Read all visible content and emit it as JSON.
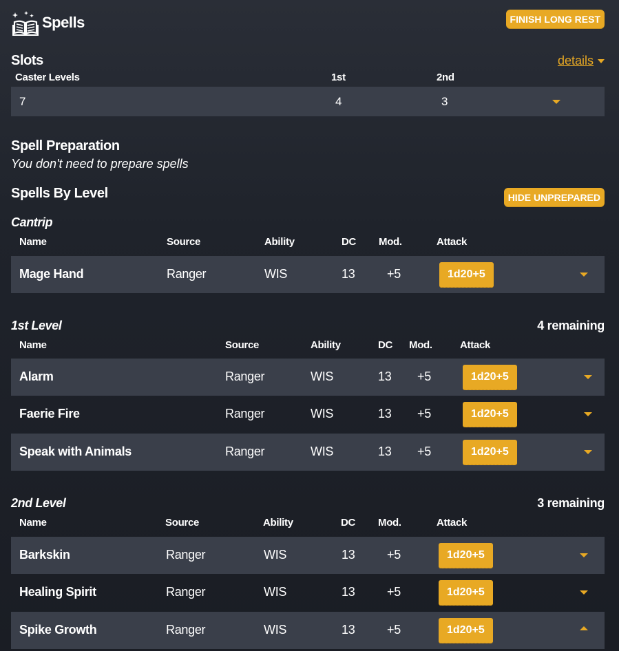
{
  "header": {
    "title": "Spells",
    "finish_label": "FINISH LONG REST"
  },
  "slots": {
    "title": "Slots",
    "details_label": "details",
    "columns": [
      "Caster Levels",
      "1st",
      "2nd"
    ],
    "values": [
      "7",
      "4",
      "3"
    ]
  },
  "preparation": {
    "title": "Spell Preparation",
    "subtitle": "You don't need to prepare spells"
  },
  "by_level": {
    "title": "Spells By Level",
    "hide_label": "HIDE UNPREPARED"
  },
  "table_headers": {
    "name": "Name",
    "source": "Source",
    "ability": "Ability",
    "dc": "DC",
    "mod": "Mod.",
    "attack": "Attack"
  },
  "cantrip": {
    "title": "Cantrip",
    "spells": [
      {
        "name": "Mage Hand",
        "source": "Ranger",
        "ability": "WIS",
        "dc": "13",
        "mod": "+5",
        "attack": "1d20+5"
      }
    ]
  },
  "level1": {
    "title": "1st Level",
    "remaining": "4 remaining",
    "spells": [
      {
        "name": "Alarm",
        "source": "Ranger",
        "ability": "WIS",
        "dc": "13",
        "mod": "+5",
        "attack": "1d20+5"
      },
      {
        "name": "Faerie Fire",
        "source": "Ranger",
        "ability": "WIS",
        "dc": "13",
        "mod": "+5",
        "attack": "1d20+5"
      },
      {
        "name": "Speak with Animals",
        "source": "Ranger",
        "ability": "WIS",
        "dc": "13",
        "mod": "+5",
        "attack": "1d20+5"
      }
    ]
  },
  "level2": {
    "title": "2nd Level",
    "remaining": "3 remaining",
    "spells": [
      {
        "name": "Barkskin",
        "source": "Ranger",
        "ability": "WIS",
        "dc": "13",
        "mod": "+5",
        "attack": "1d20+5"
      },
      {
        "name": "Healing Spirit",
        "source": "Ranger",
        "ability": "WIS",
        "dc": "13",
        "mod": "+5",
        "attack": "1d20+5"
      },
      {
        "name": "Spike Growth",
        "source": "Ranger",
        "ability": "WIS",
        "dc": "13",
        "mod": "+5",
        "attack": "1d20+5"
      }
    ]
  },
  "colors": {
    "accent": "#e8a924",
    "row_alt": "#3a3f4a"
  }
}
